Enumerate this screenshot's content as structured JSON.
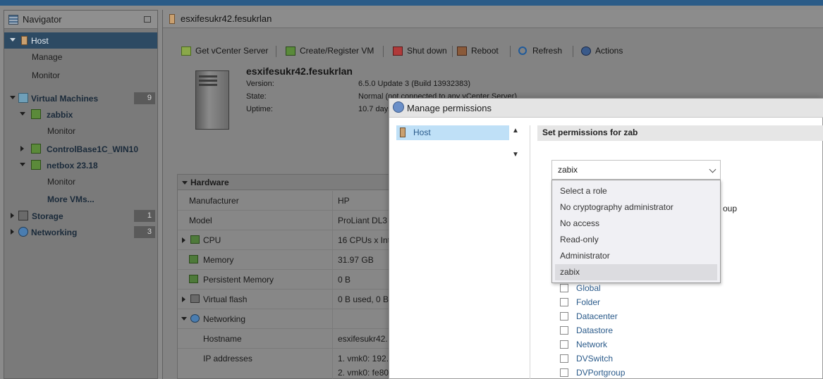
{
  "navigator": {
    "title": "Navigator",
    "items": [
      {
        "label": "Host"
      },
      {
        "label": "Manage"
      },
      {
        "label": "Monitor"
      },
      {
        "label": "Virtual Machines",
        "badge": "9"
      },
      {
        "label": "zabbix"
      },
      {
        "label": "Monitor"
      },
      {
        "label": "ControlBase1C_WIN10"
      },
      {
        "label": "netbox 23.18"
      },
      {
        "label": "Monitor"
      },
      {
        "label": "More VMs..."
      },
      {
        "label": "Storage",
        "badge": "1"
      },
      {
        "label": "Networking",
        "badge": "3"
      }
    ]
  },
  "main": {
    "title": "esxifesukr42.fesukrlan",
    "toolbar": {
      "get_vcenter": "Get vCenter Server",
      "create_register": "Create/Register VM",
      "shut_down": "Shut down",
      "reboot": "Reboot",
      "refresh": "Refresh",
      "actions": "Actions"
    },
    "host": {
      "name": "esxifesukr42.fesukrlan",
      "version_label": "Version:",
      "version_value": "6.5.0 Update 3 (Build 13932383)",
      "state_label": "State:",
      "state_value": "Normal (not connected to any vCenter Server)",
      "uptime_label": "Uptime:",
      "uptime_value": "10.7 days"
    },
    "hardware": {
      "title": "Hardware",
      "rows": [
        {
          "key": "Manufacturer",
          "value": "HP"
        },
        {
          "key": "Model",
          "value": "ProLiant DL3"
        },
        {
          "key": "CPU",
          "value": "16 CPUs x Int"
        },
        {
          "key": "Memory",
          "value": "31.97 GB"
        },
        {
          "key": "Persistent Memory",
          "value": "0 B"
        },
        {
          "key": "Virtual flash",
          "value": "0 B used, 0 B"
        },
        {
          "key": "Networking",
          "value": ""
        },
        {
          "key": "Hostname",
          "value": "esxifesukr42."
        },
        {
          "key": "IP addresses",
          "value": "1. vmk0: 192."
        },
        {
          "key": "",
          "value": "2. vmk0: fe80"
        }
      ]
    }
  },
  "dialog": {
    "title": "Manage permissions",
    "tree_item": "Host",
    "section_title": "Set permissions for zab",
    "role_select_value": "zabix",
    "role_options": [
      "Select a role",
      "No cryptography administrator",
      "No access",
      "Read-only",
      "Administrator",
      "zabix"
    ],
    "behind_text": "oup",
    "object_types": [
      "Global",
      "Folder",
      "Datacenter",
      "Datastore",
      "Network",
      "DVSwitch",
      "DVPortgroup"
    ]
  }
}
